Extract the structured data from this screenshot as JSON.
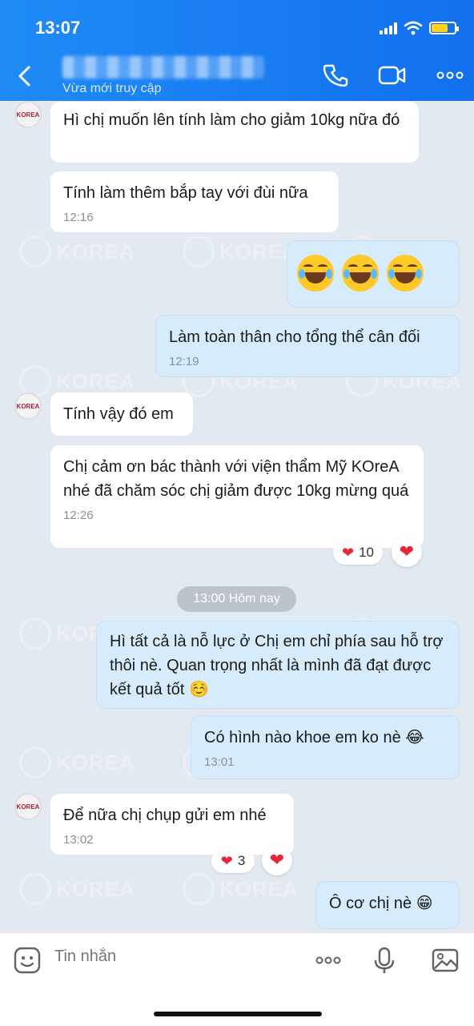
{
  "status_bar": {
    "time": "13:07"
  },
  "header": {
    "contact_name": "▒▒▒▒ ▒▒▒▒▒▒ ▒▒▒",
    "contact_status": "Vừa mới truy cập"
  },
  "watermark": {
    "text": "KOREA"
  },
  "avatar": {
    "label": "KOREA"
  },
  "messages": [
    {
      "text": "Hì chị muốn lên tính làm cho giảm 10kg nữa đó",
      "time": ""
    },
    {
      "text": "Tính làm thêm bắp tay với đùi nữa",
      "time": "12:16"
    },
    {
      "text": "",
      "time": ""
    },
    {
      "text": "Làm toàn thân cho tổng thể cân đối",
      "time": "12:19"
    },
    {
      "text": "Tính vậy đó em",
      "time": ""
    },
    {
      "text": "Chị cảm ơn bác thành với viện thẩm Mỹ KOreA nhé đã chăm sóc chị giảm được 10kg mừng quá",
      "time": "12:26"
    },
    {
      "text": "Hì tất cả là nỗ lực ở Chị em chỉ phía sau hỗ trợ thôi nè. Quan trọng nhất là mình đã đạt được kết quả tốt ☺️",
      "time": ""
    },
    {
      "text": "Có hình nào khoe em ko nè 😂",
      "time": "13:01"
    },
    {
      "text": "Để nữa chị chụp gửi em nhé",
      "time": "13:02"
    },
    {
      "text": "Ô cơ chị nè 😁",
      "time": ""
    }
  ],
  "reactions": [
    {
      "count": "10"
    },
    {
      "count": "3"
    }
  ],
  "date_divider": "13:00 Hôm nay",
  "input": {
    "placeholder": "Tin nhắn"
  },
  "colors": {
    "header": "#1a82f3",
    "incoming": "#ffffff",
    "outgoing": "#d6ecfd",
    "heart": "#e8263a"
  },
  "icons": [
    "back-icon",
    "phone-icon",
    "video-icon",
    "more-icon",
    "sticker-icon",
    "more-dots-icon",
    "microphone-icon",
    "image-icon"
  ]
}
